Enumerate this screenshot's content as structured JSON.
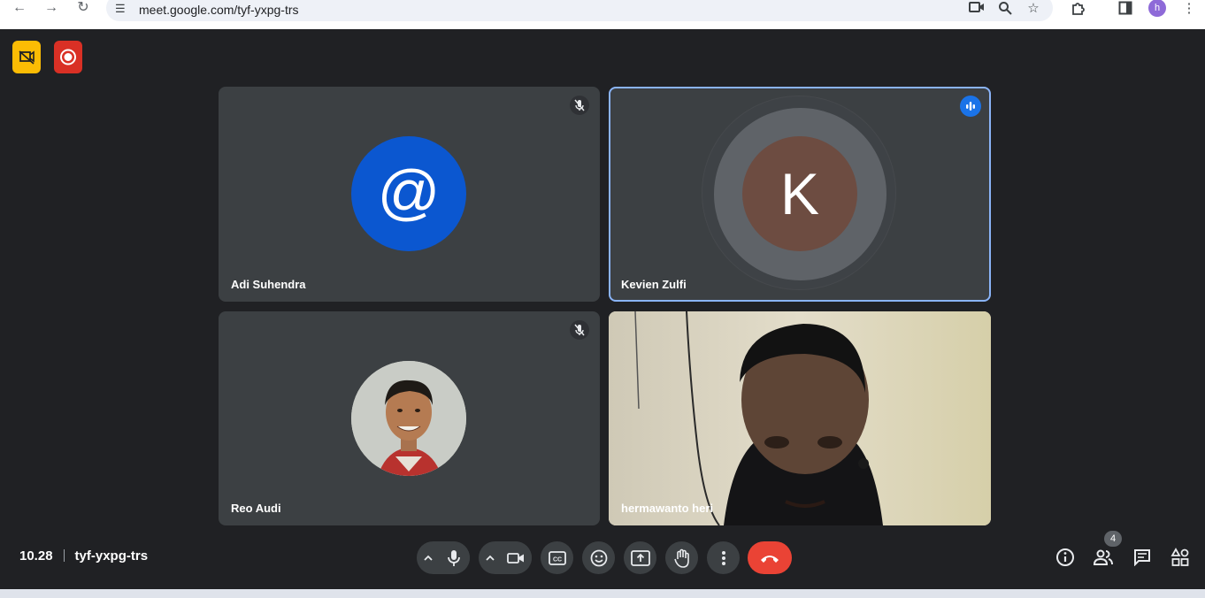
{
  "browser": {
    "url": "meet.google.com/tyf-yxpg-trs",
    "profile_initial": "h"
  },
  "colors": {
    "background": "#202124",
    "tile": "#3c4043",
    "active_border": "#8ab4f8",
    "end_call": "#ea4335",
    "badge_yellow": "#fbbc04",
    "badge_red": "#d93025"
  },
  "participants": [
    {
      "name": "Adi Suhendra",
      "avatar": "@",
      "avatar_color": "#0b57d0",
      "muted": true
    },
    {
      "name": "Kevien Zulfi",
      "avatar": "K",
      "avatar_color": "#6d4c41",
      "speaking": true
    },
    {
      "name": "Reo Audi",
      "avatar": "photo",
      "muted": true
    },
    {
      "name": "hermawanto heri",
      "avatar": "camera-video"
    }
  ],
  "meeting": {
    "time": "10.28",
    "code": "tyf-yxpg-trs",
    "people_count": "4"
  },
  "icons": {
    "top_left": [
      "no-camera-icon",
      "record-icon"
    ],
    "controls": [
      "mic-icon",
      "camera-icon",
      "captions-icon",
      "emoji-icon",
      "present-icon",
      "raise-hand-icon",
      "more-icon",
      "end-call-icon"
    ],
    "right": [
      "info-icon",
      "people-icon",
      "chat-icon",
      "activities-icon"
    ]
  }
}
